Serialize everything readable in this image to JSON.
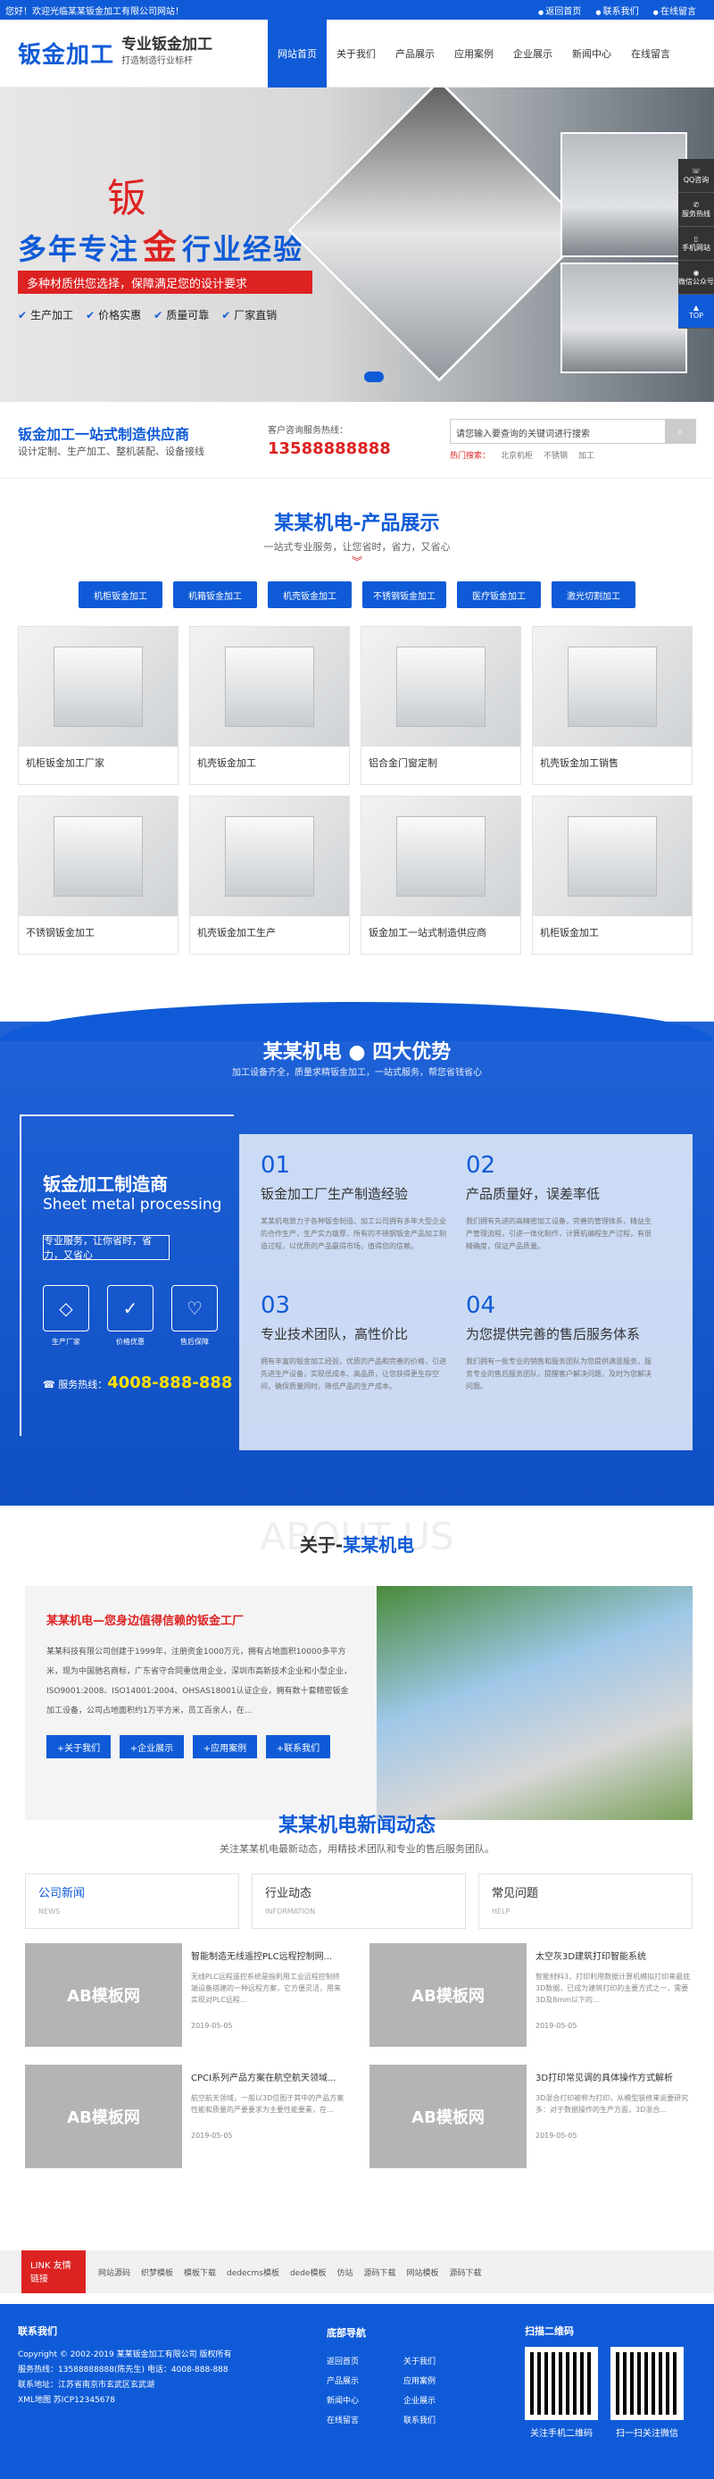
{
  "topbar": {
    "welcome": "您好！欢迎光临某某钣金加工有限公司网站！",
    "links": [
      "返回首页",
      "联系我们",
      "在线留言"
    ]
  },
  "logo": {
    "main": "钣金加工",
    "title": "专业钣金加工",
    "slogan": "打造制造行业标杆"
  },
  "nav": [
    "网站首页",
    "关于我们",
    "产品展示",
    "应用案例",
    "企业展示",
    "新闻中心",
    "在线留言"
  ],
  "banner": {
    "big_char": "钣",
    "headline_left": "多年专注",
    "headline_mid": "金",
    "headline_right": "行业经验",
    "red_bar": "多种材质供您选择，保障满足您的设计要求",
    "checks": [
      "生产加工",
      "价格实惠",
      "质量可靠",
      "厂家直销"
    ]
  },
  "float": [
    "QQ咨询",
    "服务热线",
    "手机网站",
    "微信公众号",
    "TOP"
  ],
  "info": {
    "title": "钣金加工一站式制造供应商",
    "desc": "设计定制、生产加工、整机装配、设备接线",
    "hotline_label": "客户咨询服务热线：",
    "phone": "13588888888",
    "search_placeholder": "请您输入要查询的关键词进行搜索",
    "keywords_label": "热门搜索：",
    "keywords": [
      "北京机柜",
      "不锈钢",
      "加工"
    ]
  },
  "products": {
    "title": "某某机电-产品展示",
    "sub": "一站式专业服务，让您省时，省力，又省心",
    "cats": [
      "机柜钣金加工",
      "机箱钣金加工",
      "机壳钣金加工",
      "不锈钢钣金加工",
      "医疗钣金加工",
      "激光切割加工"
    ],
    "items": [
      "机柜钣金加工厂家",
      "机壳钣金加工",
      "铝合金门窗定制",
      "机壳钣金加工销售",
      "不锈钢钣金加工",
      "机壳钣金加工生产",
      "钣金加工一站式制造供应商",
      "机柜钣金加工"
    ]
  },
  "adv": {
    "title": "某某机电 ● 四大优势",
    "sub": "加工设备齐全，质量求精钣金加工，一站式服务，帮您省钱省心",
    "left_title": "钣金加工制造商",
    "left_en": "Sheet metal processing",
    "pill": "专业服务，让你省时，省力，又省心",
    "icons": [
      "生产厂家",
      "价格优惠",
      "售后保障"
    ],
    "phone_label": "服务热线：",
    "phone": "4008-888-888",
    "items": [
      {
        "no": "01",
        "t": "钣金加工厂生产制造经验",
        "d": "某某机电致力于各种钣金制造、加工公司拥有多年大型企业的合作生产，生产实力雄厚，所有的不锈钢钣金产品加工制造过程，以优质的产品赢得市场，值得您的信赖。"
      },
      {
        "no": "02",
        "t": "产品质量好，误差率低",
        "d": "我们拥有先进的高精密加工设备，完善的管理体系，精益生产管理流程，引进一体化制作，计算机编程生产过程，有很精确度，保证产品质量。"
      },
      {
        "no": "03",
        "t": "专业技术团队，高性价比",
        "d": "拥有丰富的钣金加工经验，优质的产品和完善的价格，引进先进生产设备，实现低成本、高品质，让您获得更生存空间，确保质量同时，降低产品的生产成本。"
      },
      {
        "no": "04",
        "t": "为您提供完善的售后服务体系",
        "d": "我们拥有一批专业的销售和服务团队为您提供满意服务，服务专业的售后服务团队，提醒客户解决问题，及时为您解决问题。"
      }
    ]
  },
  "about": {
    "ghost": "ABOUT US",
    "pre": "关于-",
    "name": "某某机电",
    "headline": "某某机电—您身边值得信赖的钣金工厂",
    "body": "某某科技有限公司创建于1999年，注册资金1000万元，拥有占地面积10000多平方米，现为中国驰名商标，广东省守合同重信用企业，深圳市高新技术企业和小型企业，ISO9001:2008、ISO14001:2004、OHSAS18001认证企业，拥有数十套精密钣金加工设备，公司占地面积约1万平方米，员工百余人，在...",
    "btns": [
      "+关于我们",
      "+企业展示",
      "+应用案例",
      "+联系我们"
    ]
  },
  "news": {
    "title": "某某机电新闻动态",
    "sub": "关注某某机电最新动态，用精技术团队和专业的售后服务团队。",
    "tabs": [
      {
        "t": "公司新闻",
        "e": "NEWS"
      },
      {
        "t": "行业动态",
        "e": "INFORMATION"
      },
      {
        "t": "常见问题",
        "e": "HELP"
      }
    ],
    "thumb": "AB模板网",
    "items": [
      {
        "t": "智能制造无线遥控PLC远程控制网...",
        "d": "无线PLC远程遥控系统是指利用工业远程控制终端设备搭建的一种远程方案，它方便灵活，用来实现对PLC远程...",
        "date": "2019-05-05"
      },
      {
        "t": "太空灰3D建筑打印智能系统",
        "d": "智能材料3，打印利用数据计算机模拟打印来最底3D数据，已成为建筑打印的主要方式之一，需要3D及8mm以下的...",
        "date": "2019-05-05"
      },
      {
        "t": "CPCI系列产品方案在航空航天领域...",
        "d": "航空航天领域，一般以3D位图于其中的产品方案性能和质量的严要要求为主要性能要素，在...",
        "date": "2019-05-05"
      },
      {
        "t": "3D打印常见调的具体操作方式解析",
        "d": "3D混合打印被称为打印，从模型装修来说要研究多：对于数据操作的生产方面，3D混合...",
        "date": "2019-05-05"
      }
    ]
  },
  "links": {
    "label": "LINK 友情链接",
    "items": [
      "网站源码",
      "织梦模板",
      "模板下载",
      "dedecms模板",
      "dede模板",
      "仿站",
      "源码下载",
      "网站模板",
      "源码下载"
    ]
  },
  "footer": {
    "contact_title": "联系我们",
    "lines": [
      "Copyright © 2002-2019 某某钣金加工有限公司 版权所有",
      "服务热线：13588888888(陈先生)   电话：4008-888-888",
      "联系地址：江苏省南京市玄武区玄武湖",
      "XML地图   苏ICP12345678"
    ],
    "nav_title": "底部导航",
    "nav_col1": [
      "返回首页",
      "产品展示",
      "新闻中心",
      "在线留言"
    ],
    "nav_col2": [
      "关于我们",
      "应用案例",
      "企业展示",
      "联系我们"
    ],
    "qr_title": "扫描二维码",
    "qr": [
      "关注手机二维码",
      "扫一扫关注微信"
    ]
  }
}
